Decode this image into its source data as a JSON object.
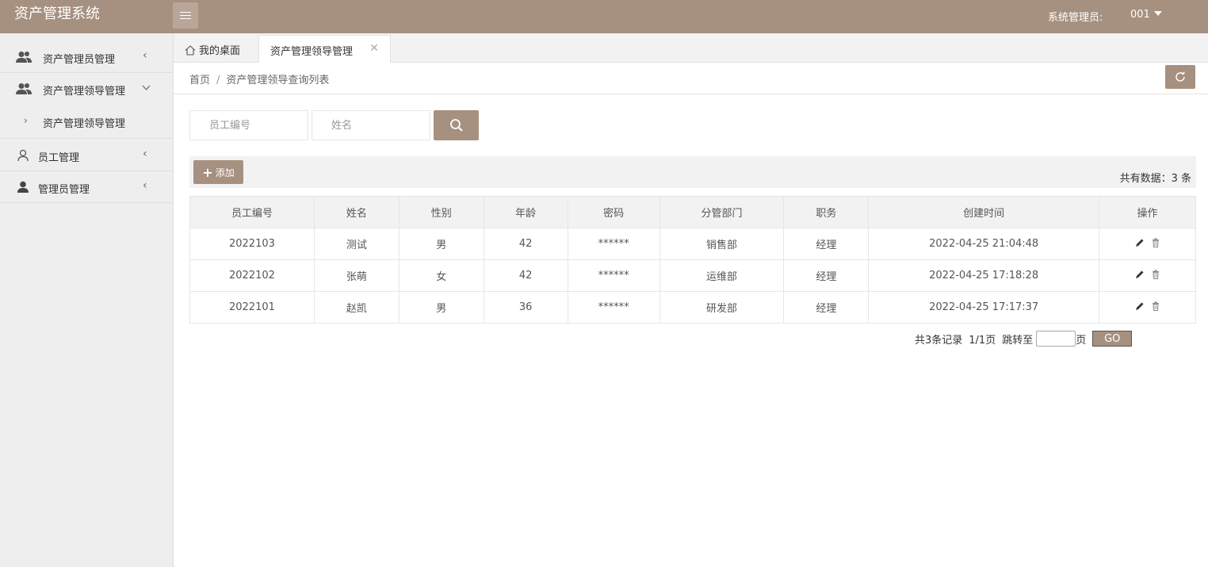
{
  "app": {
    "title": "资产管理系统"
  },
  "user": {
    "role": "系统管理员:",
    "id": "001"
  },
  "sidebar": {
    "items": [
      {
        "label": "资产管理员管理",
        "icon": "users-icon",
        "expanded": false
      },
      {
        "label": "资产管理领导管理",
        "icon": "users-icon",
        "expanded": true,
        "children": [
          {
            "label": "资产管理领导管理"
          }
        ]
      },
      {
        "label": "员工管理",
        "icon": "user-outline-icon",
        "expanded": false
      },
      {
        "label": "管理员管理",
        "icon": "user-icon",
        "expanded": false
      }
    ]
  },
  "tabs": [
    {
      "label": "我的桌面",
      "icon": "home-icon",
      "active": false
    },
    {
      "label": "资产管理领导管理",
      "active": true,
      "closable": true
    }
  ],
  "breadcrumb": {
    "home": "首页",
    "separator": "/",
    "current": "资产管理领导查询列表"
  },
  "search": {
    "employee_id_placeholder": "员工编号",
    "name_placeholder": "姓名"
  },
  "toolbar": {
    "add_label": "添加",
    "total_text": "共有数据：3 条"
  },
  "table": {
    "columns": [
      "员工编号",
      "姓名",
      "性别",
      "年龄",
      "密码",
      "分管部门",
      "职务",
      "创建时间",
      "操作"
    ],
    "rows": [
      {
        "id": "2022103",
        "name": "测试",
        "gender": "男",
        "age": "42",
        "password": "******",
        "dept": "销售部",
        "title": "经理",
        "created": "2022-04-25 21:04:48"
      },
      {
        "id": "2022102",
        "name": "张萌",
        "gender": "女",
        "age": "42",
        "password": "******",
        "dept": "运维部",
        "title": "经理",
        "created": "2022-04-25 17:18:28"
      },
      {
        "id": "2022101",
        "name": "赵凯",
        "gender": "男",
        "age": "36",
        "password": "******",
        "dept": "研发部",
        "title": "经理",
        "created": "2022-04-25 17:17:37"
      }
    ]
  },
  "pager": {
    "records": "共3条记录",
    "pages": "1/1页",
    "jump_to": "跳转至",
    "page_unit": "页",
    "go": "GO"
  },
  "colors": {
    "accent": "#a69080",
    "sidebar_bg": "#eeeeee"
  }
}
